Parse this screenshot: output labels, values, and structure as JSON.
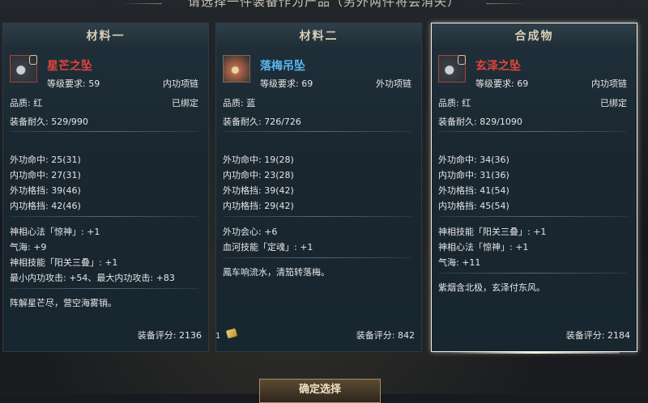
{
  "header": {
    "title": "请选择一件装备作为产品（另外两件将会消失）"
  },
  "cards": [
    {
      "header": "材料一",
      "item_name": "星芒之坠",
      "level_req": "等级要求: 59",
      "slot": "内功项链",
      "quality": "品质: 红",
      "bound": "已绑定",
      "durability": "装备耐久: 529/990",
      "stats": [
        "外功命中: 25(31)",
        "内功命中: 27(31)",
        "外功格挡: 39(46)",
        "内功格挡: 42(46)"
      ],
      "bonuses": [
        "神相心法「惊神」: +1",
        "气海: +9",
        "神相技能「阳关三叠」: +1",
        "最小内功攻击: +54、最大内功攻击: +83"
      ],
      "flavor": "阵解星芒尽，营空海雾销。",
      "score": "装备评分: 2136"
    },
    {
      "header": "材料二",
      "item_name": "落梅吊坠",
      "level_req": "等级要求: 69",
      "slot": "外功项链",
      "quality": "品质: 蓝",
      "bound": "",
      "durability": "装备耐久: 726/726",
      "stats": [
        "外功命中: 19(28)",
        "内功命中: 23(28)",
        "外功格挡: 39(42)",
        "内功格挡: 29(42)"
      ],
      "bonuses": [
        "外功会心: +6",
        "血河技能「定魂」: +1"
      ],
      "flavor": "鳳车响流水，清笳转落梅。",
      "score": "装备评分: 842",
      "stack_count": "1"
    },
    {
      "header": "合成物",
      "item_name": "玄泽之坠",
      "level_req": "等级要求: 69",
      "slot": "内功项链",
      "quality": "品质: 红",
      "bound": "已绑定",
      "durability": "装备耐久: 829/1090",
      "stats": [
        "外功命中: 34(36)",
        "内功命中: 31(36)",
        "外功格挡: 41(54)",
        "内功格挡: 45(54)"
      ],
      "bonuses": [
        "神相技能「阳关三叠」: +1",
        "神相心法「惊神」: +1",
        "气海: +11"
      ],
      "flavor": "紫烟含北极，玄泽付东风。",
      "score": "装备评分: 2184"
    }
  ],
  "confirm_button": "确定选择",
  "colors": {
    "red_quality": "#e0453c",
    "blue_quality": "#58b6ee",
    "bound": "#e8c55a",
    "bonus": "#e86a6a",
    "bonus_blue": "#58b6ee"
  }
}
